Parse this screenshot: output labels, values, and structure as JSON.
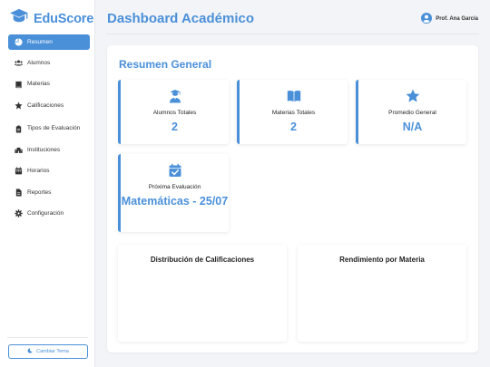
{
  "app": {
    "name": "EduScore",
    "logo_icon": "graduation-cap-icon"
  },
  "colors": {
    "accent": "#4a90d9",
    "background": "#f3f4f7",
    "card": "#ffffff"
  },
  "sidebar": {
    "items": [
      {
        "label": "Resumen",
        "icon": "pie-chart-icon",
        "active": true
      },
      {
        "label": "Alumnos",
        "icon": "users-icon"
      },
      {
        "label": "Materias",
        "icon": "book-icon"
      },
      {
        "label": "Calificaciones",
        "icon": "star-icon"
      },
      {
        "label": "Tipos de Evaluación",
        "icon": "clipboard-icon"
      },
      {
        "label": "Instituciones",
        "icon": "building-icon"
      },
      {
        "label": "Horarios",
        "icon": "calendar-icon"
      },
      {
        "label": "Reportes",
        "icon": "file-icon"
      },
      {
        "label": "Configuración",
        "icon": "gear-icon"
      }
    ],
    "theme_button": {
      "label": "Cambiar Tema",
      "icon": "moon-icon"
    }
  },
  "header": {
    "title": "Dashboard Académico",
    "user": "Prof. Ana García",
    "user_icon": "user-circle-icon"
  },
  "main": {
    "section_title": "Resumen General",
    "cards": [
      {
        "label": "Alumnos Totales",
        "value": "2",
        "icon": "user-graduate-icon"
      },
      {
        "label": "Materias Totales",
        "value": "2",
        "icon": "book-open-icon"
      },
      {
        "label": "Promedio General",
        "value": "N/A",
        "icon": "star-icon"
      },
      {
        "label": "Próxima Evaluación",
        "value": "Matemáticas - 25/07",
        "icon": "calendar-check-icon"
      }
    ],
    "charts": [
      {
        "title": "Distribución de Calificaciones"
      },
      {
        "title": "Rendimiento por Materia"
      }
    ]
  }
}
